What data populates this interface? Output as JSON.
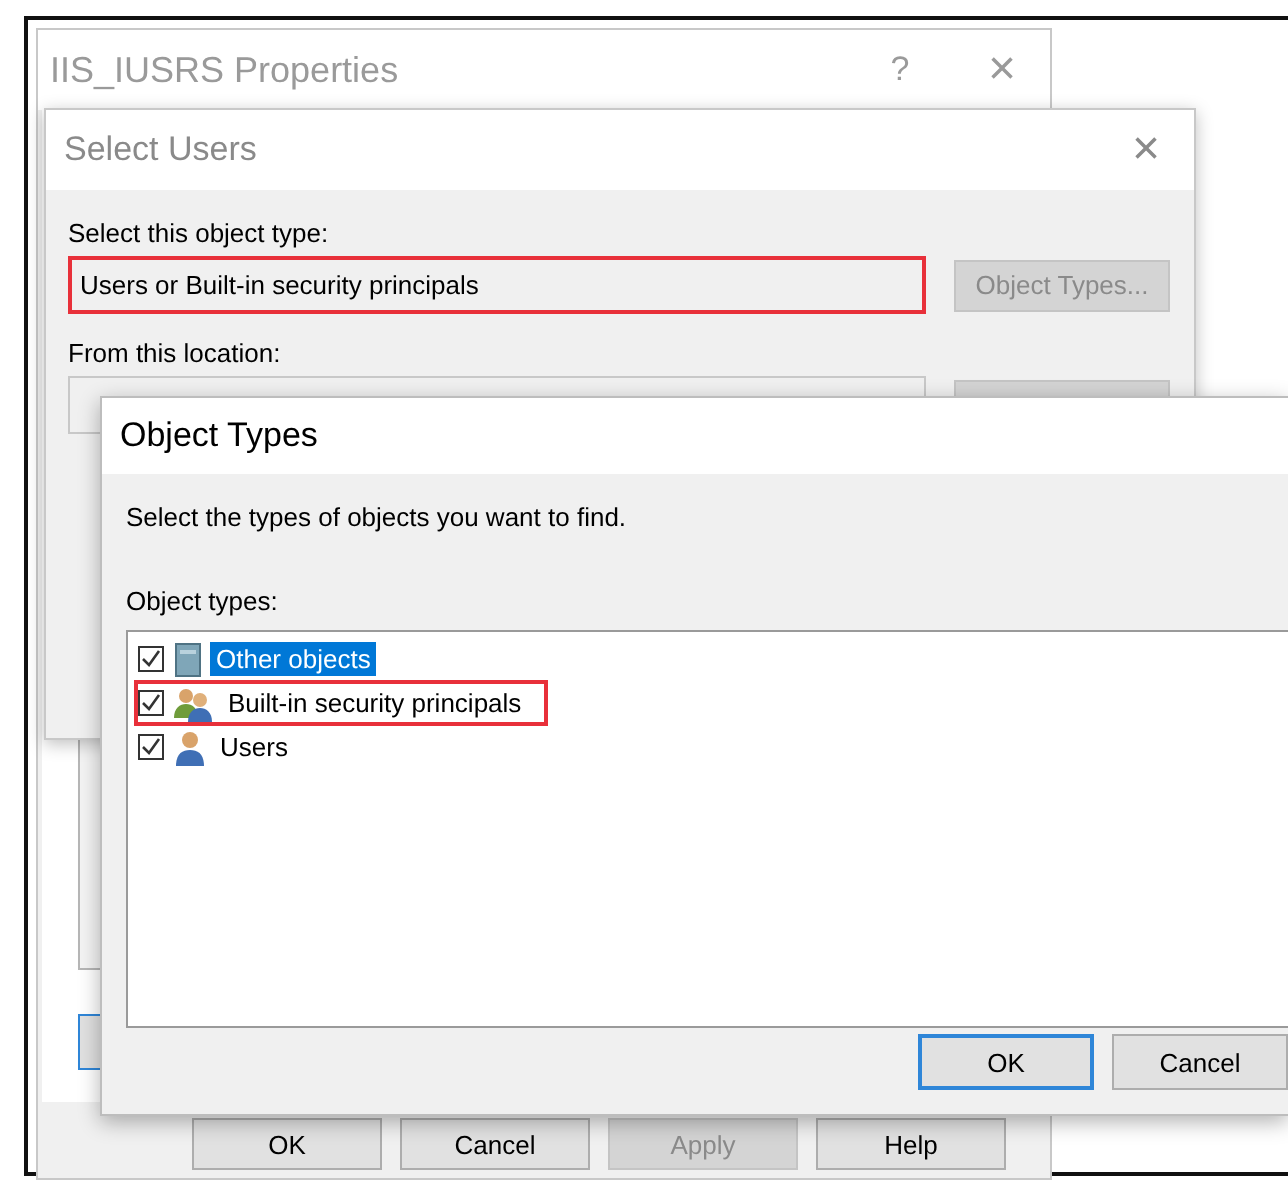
{
  "properties_window": {
    "title": "IIS_IUSRS Properties",
    "help_glyph": "?",
    "close_glyph": "×",
    "buttons": [
      {
        "label": "OK",
        "disabled": false
      },
      {
        "label": "Cancel",
        "disabled": false
      },
      {
        "label": "Apply",
        "disabled": true
      },
      {
        "label": "Help",
        "disabled": false
      }
    ]
  },
  "select_users_dialog": {
    "title": "Select Users",
    "close_glyph": "×",
    "object_type_label": "Select this object type:",
    "object_type_value": "Users or Built-in security principals",
    "object_type_highlighted": true,
    "object_types_button": {
      "label": "Object Types...",
      "disabled": true
    },
    "location_label": "From this location:"
  },
  "object_types_dialog": {
    "title": "Object Types",
    "instruction": "Select the types of objects you want to find.",
    "list_label": "Object types:",
    "items": [
      {
        "label": "Other objects",
        "kind": "other",
        "checked": true,
        "selected": true,
        "highlighted": false
      },
      {
        "label": "Built-in security principals",
        "kind": "group",
        "checked": true,
        "selected": false,
        "highlighted": true
      },
      {
        "label": "Users",
        "kind": "user",
        "checked": true,
        "selected": false,
        "highlighted": false
      }
    ],
    "buttons": [
      {
        "label": "OK",
        "default": true
      },
      {
        "label": "Cancel",
        "default": false
      }
    ]
  }
}
